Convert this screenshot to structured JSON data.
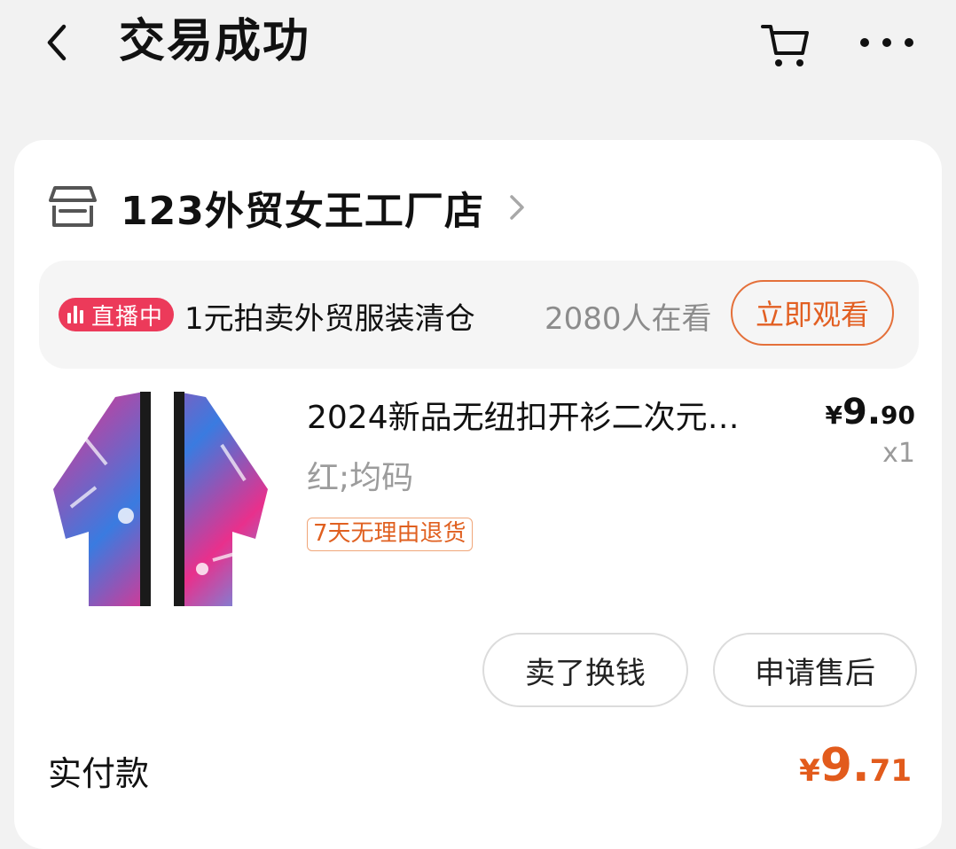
{
  "header": {
    "title": "交易成功"
  },
  "shop": {
    "name": "123外贸女王工厂店"
  },
  "live": {
    "badge": "直播中",
    "title": "1元拍卖外贸服装清仓",
    "viewers": "2080人在看",
    "watch_label": "立即观看",
    "badge_color": "#ec3a5a"
  },
  "product": {
    "title": "2024新品无纽扣开衫二次元…",
    "price_symbol": "¥",
    "price_int": "9.",
    "price_dec": "90",
    "quantity": "x1",
    "sku": "红;均码",
    "return_tag": "7天无理由退货"
  },
  "actions": {
    "sell_label": "卖了换钱",
    "after_sale_label": "申请售后"
  },
  "payment": {
    "label": "实付款",
    "symbol": "¥",
    "int": "9.",
    "dec": "71",
    "color": "#e25b1c"
  }
}
